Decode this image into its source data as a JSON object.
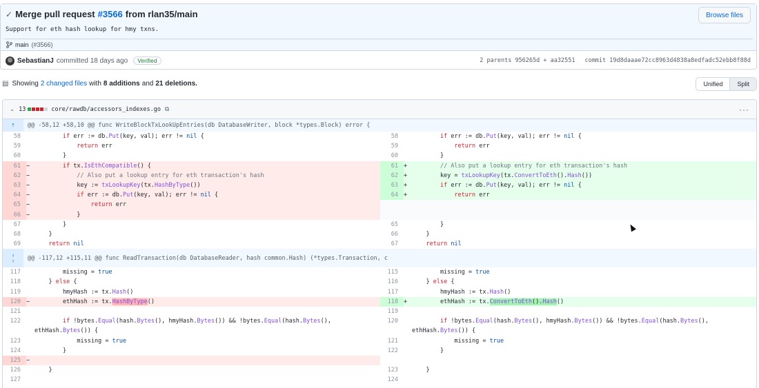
{
  "commit": {
    "check": "✓",
    "title_prefix": "Merge pull request",
    "pr_link": "#3566",
    "title_suffix": "from rlan35/main",
    "description": "Support for eth hash lookup for hmy txns.",
    "branch": "main",
    "branch_pr": "(#3566)",
    "browse_files": "Browse files",
    "author": "SebastianJ",
    "committed": "committed 18 days ago",
    "verified": "Verified",
    "parents_label": "2 parents",
    "parent1": "956265d",
    "parent2": "aa32551",
    "commit_label": "commit",
    "sha": "19d8daaae72cc8963d4838a8edfadc52ebb8f88d"
  },
  "summary": {
    "showing": "Showing",
    "changed": "2 changed files",
    "with": "with",
    "additions": "8 additions",
    "and": "and",
    "deletions": "21 deletions.",
    "unified": "Unified",
    "split": "Split"
  },
  "file": {
    "count": "13",
    "path": "core/rawdb/accessors_indexes.go",
    "kebab": "···"
  },
  "hunks": [
    "@@ -58,12 +58,10 @@ func WriteBlockTxLookUpEntries(db DatabaseWriter, block *types.Block) error {",
    "@@ -117,12 +115,11 @@ func ReadTransaction(db DatabaseReader, hash common.Hash) (*types.Transaction, c"
  ],
  "line_numbers": {
    "l": [
      "58",
      "59",
      "60",
      "61",
      "62",
      "63",
      "64",
      "65",
      "66",
      "67",
      "68",
      "69",
      "117",
      "118",
      "119",
      "120",
      "121",
      "122",
      "123",
      "124",
      "125",
      "126",
      "127"
    ],
    "r": [
      "58",
      "59",
      "60",
      "61",
      "62",
      "63",
      "64",
      "65",
      "66",
      "67",
      "115",
      "116",
      "117",
      "118",
      "119",
      "120",
      "121",
      "122",
      "123",
      "124"
    ]
  },
  "signs": {
    "minus": "−",
    "plus": "+"
  }
}
